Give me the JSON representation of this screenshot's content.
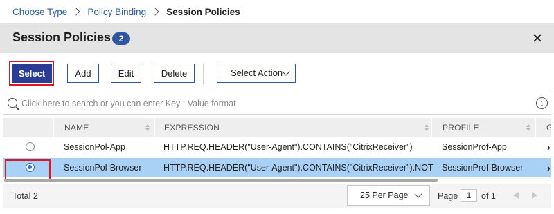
{
  "breadcrumb": {
    "items": [
      "Choose Type",
      "Policy Binding"
    ],
    "current": "Session Policies"
  },
  "header": {
    "title": "Session Policies",
    "count": "2"
  },
  "toolbar": {
    "select_label": "Select",
    "add_label": "Add",
    "edit_label": "Edit",
    "delete_label": "Delete",
    "action_label": "Select Action"
  },
  "search": {
    "placeholder": "Click here to search or you can enter Key : Value format",
    "value": ""
  },
  "table": {
    "columns": [
      "NAME",
      "EXPRESSION",
      "PROFILE",
      "G"
    ],
    "rows": [
      {
        "selected": false,
        "name": "SessionPol-App",
        "expression": "HTTP.REQ.HEADER(\"User-Agent\").CONTAINS(\"CitrixReceiver\")",
        "profile": "SessionProf-App"
      },
      {
        "selected": true,
        "name": "SessionPol-Browser",
        "expression": "HTTP.REQ.HEADER(\"User-Agent\").CONTAINS(\"CitrixReceiver\").NOT",
        "profile": "SessionProf-Browser"
      }
    ]
  },
  "footer": {
    "total_label": "Total",
    "total_count": "2",
    "per_page": "25 Per Page",
    "page_label": "Page",
    "page_value": "1",
    "page_of": "of 1"
  },
  "colors": {
    "primary": "#2c3b93",
    "highlight": "#e0141e",
    "selected_row": "#a9d1f6",
    "link": "#2f5f9e"
  }
}
